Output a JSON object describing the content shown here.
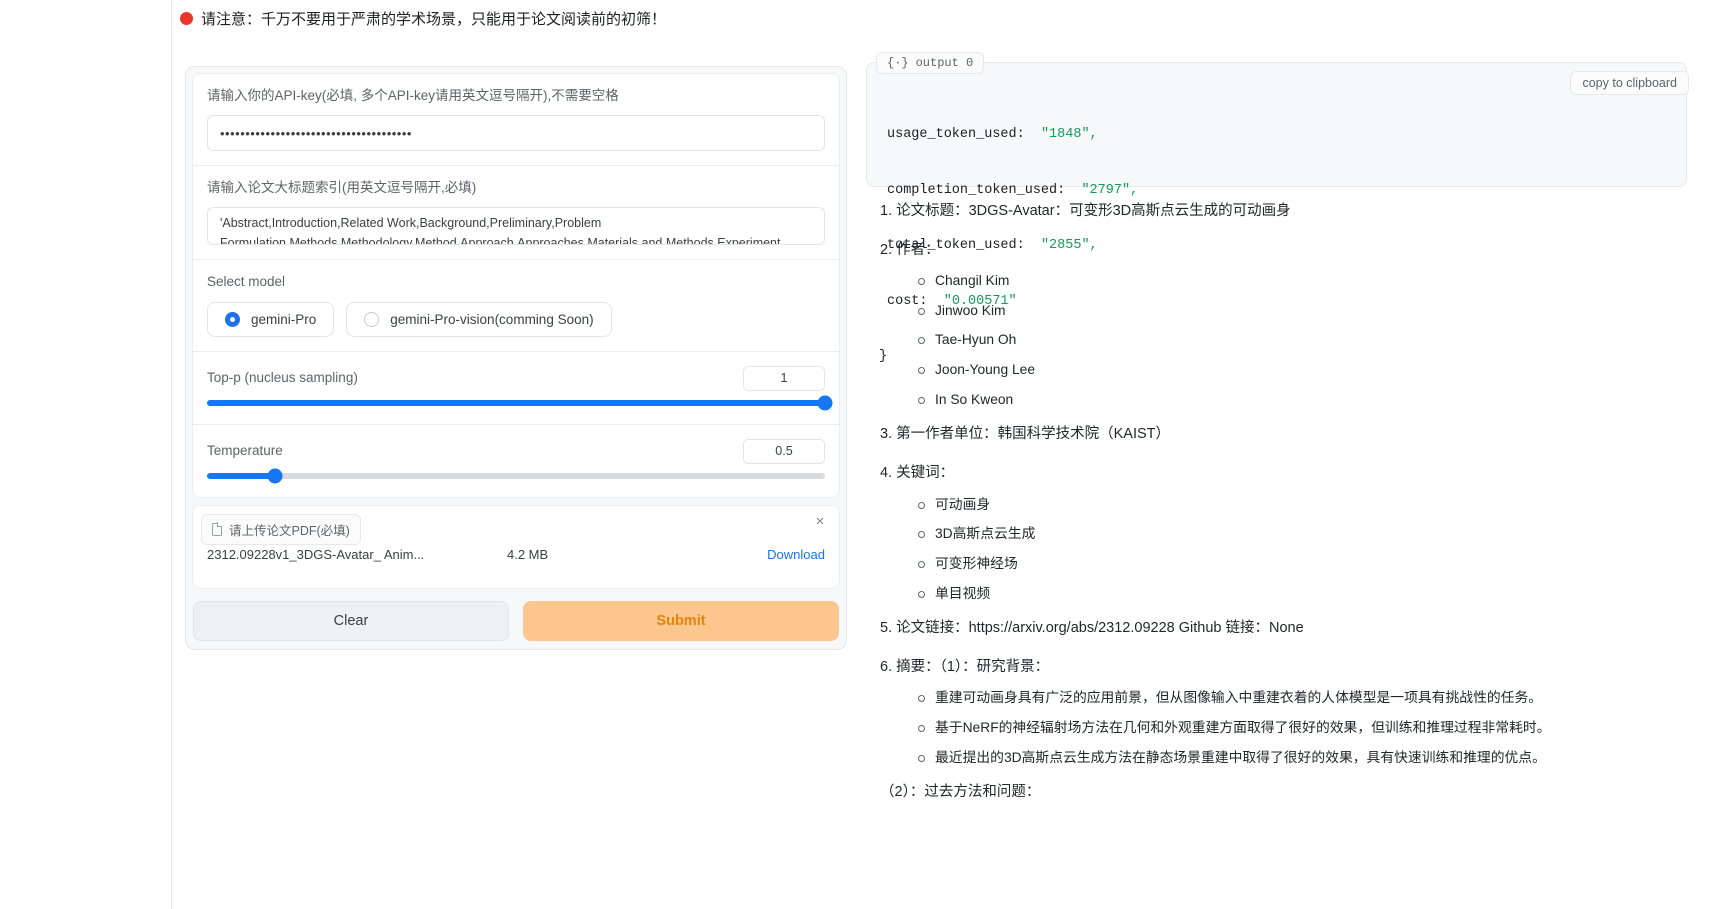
{
  "notice": {
    "text": "请注意：千万不要用于严肃的学术场景，只能用于论文阅读前的初筛！",
    "dot_color": "#e8362a"
  },
  "form": {
    "api_key": {
      "label": "请输入你的API-key(必填, 多个API-key请用英文逗号隔开),不需要空格",
      "value": "••••••••••••••••••••••••••••••••••••••"
    },
    "section_index": {
      "label": "请输入论文大标题索引(用英文逗号隔开,必填)",
      "value": "'Abstract,Introduction,Related Work,Background,Preliminary,Problem Formulation,Methods,Methodology,Method,Approach,Approaches,Materials and Methods,Experiment"
    },
    "model": {
      "label": "Select model",
      "options": [
        {
          "label": "gemini-Pro",
          "selected": true
        },
        {
          "label": "gemini-Pro-vision(comming Soon)",
          "selected": false
        }
      ]
    },
    "top_p": {
      "label": "Top-p (nucleus sampling)",
      "value": "1",
      "percent": 100
    },
    "temperature": {
      "label": "Temperature",
      "value": "0.5",
      "percent": 11
    },
    "upload": {
      "tab_label": "请上传论文PDF(必填)",
      "file_name": "2312.09228v1_3DGS-Avatar_ Anim...",
      "file_size": "4.2 MB",
      "download_label": "Download",
      "close_label": "×"
    },
    "buttons": {
      "clear": "Clear",
      "submit": "Submit"
    }
  },
  "output": {
    "tab_icon": "{·}",
    "tab_label": "output 0",
    "copy_label": "copy to clipboard",
    "json": [
      {
        "key": "usage_token_used:",
        "value": "\"1848\","
      },
      {
        "key": "completion_token_used:",
        "value": "\"2797\","
      },
      {
        "key": "total_token_used:",
        "value": "\"2855\","
      },
      {
        "key": "cost:",
        "value": "\"0.00571\""
      }
    ],
    "closing_brace": "}"
  },
  "result": {
    "title_line": "1. 论文标题：3DGS-Avatar：可变形3D高斯点云生成的可动画身",
    "authors_heading": "2. 作者：",
    "authors": [
      "Changil Kim",
      "Jinwoo Kim",
      "Tae-Hyun Oh",
      "Joon-Young Lee",
      "In So Kweon"
    ],
    "affiliation_line": "3. 第一作者单位：韩国科学技术院（KAIST）",
    "keywords_heading": "4. 关键词：",
    "keywords": [
      "可动画身",
      "3D高斯点云生成",
      "可变形神经场",
      "单目视频"
    ],
    "links_line": "5. 论文链接：https://arxiv.org/abs/2312.09228 Github 链接：None",
    "abstract_heading": "6. 摘要：（1）：研究背景：",
    "background_points": [
      "重建可动画身具有广泛的应用前景，但从图像输入中重建衣着的人体模型是一项具有挑战性的任务。",
      "基于NeRF的神经辐射场方法在几何和外观重建方面取得了很好的效果，但训练和推理过程非常耗时。",
      "最近提出的3D高斯点云生成方法在静态场景重建中取得了很好的效果，具有快速训练和推理的优点。"
    ],
    "past_methods_line": "（2）：过去方法和问题："
  }
}
